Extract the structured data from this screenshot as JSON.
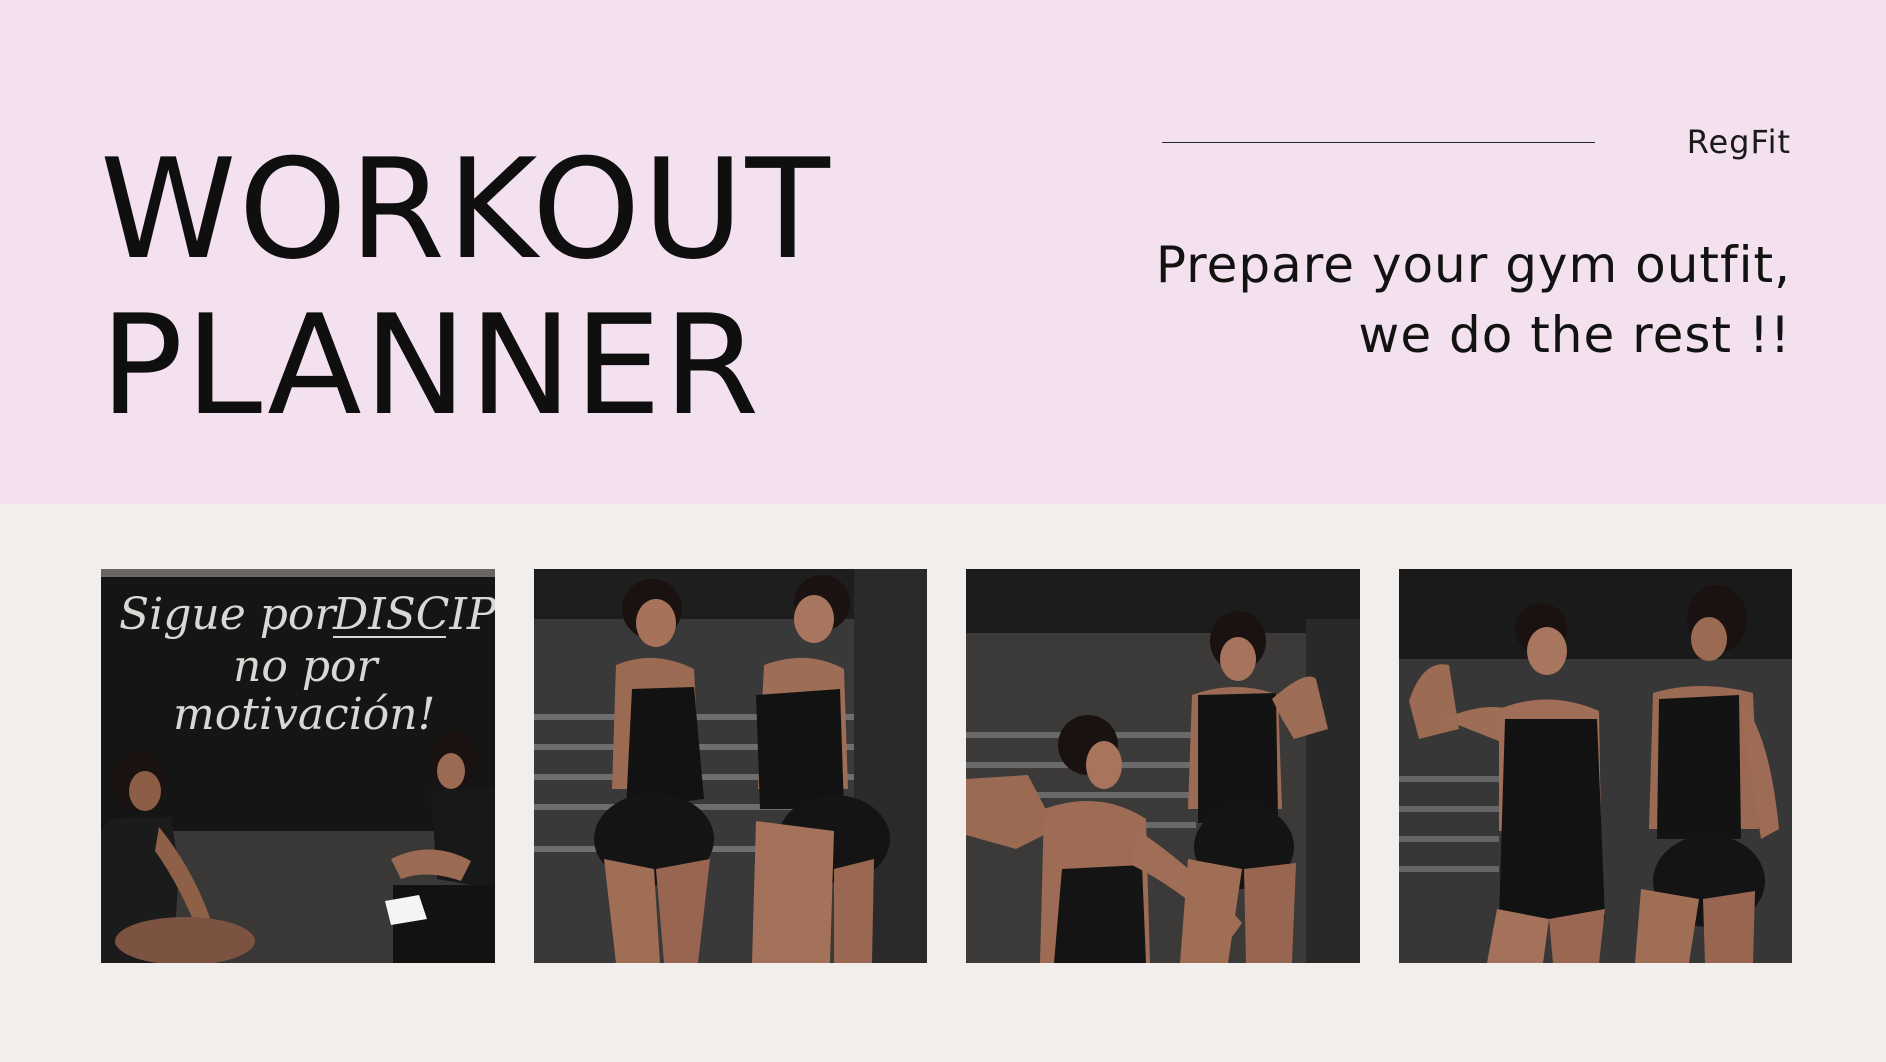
{
  "hero": {
    "title_line1": "WORKOUT",
    "title_line2": "PLANNER",
    "brand": "RegFit",
    "tagline_line1": "Prepare your gym outfit,",
    "tagline_line2": "we do the rest !!"
  },
  "gallery": {
    "photos": [
      {
        "chalkboard": {
          "line1": "Sigue por",
          "word_underlined": "DISCIPLINA,",
          "line2": "no por",
          "line3": "motivación!"
        }
      },
      {},
      {},
      {}
    ]
  },
  "colors": {
    "hero_background": "#f3e1f0",
    "page_background": "#f2eeec",
    "text": "#0f0f10"
  }
}
